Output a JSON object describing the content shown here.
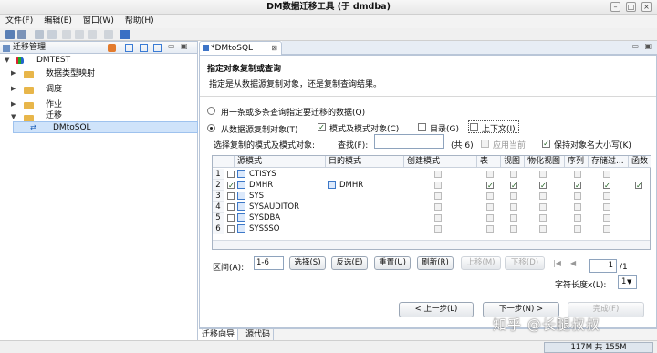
{
  "window": {
    "title": "DM数据迁移工具 (于 dmdba)"
  },
  "menu": [
    "文件(F)",
    "编辑(E)",
    "窗口(W)",
    "帮助(H)"
  ],
  "left_panel": {
    "title": "迁移管理",
    "tree": {
      "root": "DMTEST",
      "items": [
        "数据类型映射",
        "调度",
        "作业",
        "迁移"
      ],
      "selected": "DMtoSQL"
    }
  },
  "editor_tab": {
    "label": "*DMtoSQL"
  },
  "wizard": {
    "heading": "指定对象复制或查询",
    "description": "指定是从数据源复制对象，还是复制查询结果。",
    "radio_query": "用一条或多条查询指定要迁移的数据(Q)",
    "radio_copy": "从数据源复制对象(T)",
    "chk_schema": "模式及模式对象(C)",
    "chk_catalog": "目录(G)",
    "chk_context": "上下文(I)",
    "select_label": "选择复制的模式及模式对象:",
    "search_label": "查找(F):",
    "search_value": "",
    "count_text": "(共 6)",
    "chk_apply_current": "应用当前",
    "chk_keep_case": "保持对象名大小写(K)"
  },
  "grid": {
    "headers": [
      "源模式",
      "目的模式",
      "创建模式",
      "表",
      "视图",
      "物化视图",
      "序列",
      "存储过...",
      "函数"
    ],
    "rows": [
      {
        "n": "1",
        "checked": false,
        "src": "CTISYS",
        "dst": "",
        "opts": false
      },
      {
        "n": "2",
        "checked": true,
        "src": "DMHR",
        "dst": "DMHR",
        "opts": true
      },
      {
        "n": "3",
        "checked": false,
        "src": "SYS",
        "dst": "",
        "opts": false
      },
      {
        "n": "4",
        "checked": false,
        "src": "SYSAUDITOR",
        "dst": "",
        "opts": false
      },
      {
        "n": "5",
        "checked": false,
        "src": "SYSDBA",
        "dst": "",
        "opts": false
      },
      {
        "n": "6",
        "checked": false,
        "src": "SYSSSO",
        "dst": "",
        "opts": false
      }
    ]
  },
  "range": {
    "label": "区间(A):",
    "value": "1-6"
  },
  "range_buttons": [
    "选择(S)",
    "反选(E)",
    "重置(U)",
    "刷新(R)",
    "上移(M)",
    "下移(D)"
  ],
  "paging": {
    "page": "1",
    "total": "/1"
  },
  "char_len": {
    "label": "字符长度x(L):",
    "value": "1"
  },
  "nav": {
    "back": "< 上一步(L)",
    "next": "下一步(N) >",
    "finish": "完成(F)"
  },
  "bottom_tabs": [
    "迁移向导",
    "源代码"
  ],
  "status": {
    "memory": "117M 共 155M"
  },
  "watermark": "知乎 @长腿叔叔"
}
